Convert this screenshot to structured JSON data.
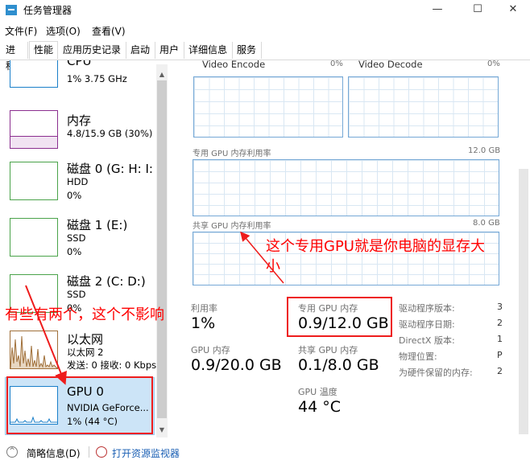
{
  "window": {
    "title": "任务管理器",
    "minimize_glyph": "—",
    "maximize_glyph": "☐",
    "close_glyph": "✕"
  },
  "menu": [
    "文件(F)",
    "选项(O)",
    "查看(V)"
  ],
  "tabs": [
    "进程",
    "性能",
    "应用历史记录",
    "启动",
    "用户",
    "详细信息",
    "服务"
  ],
  "active_tab": "性能",
  "sidebar": {
    "items": [
      {
        "title": "CPU",
        "sub1": "1% 3.75 GHz",
        "sub2": "",
        "sub3": "",
        "color": "#1a7fc9"
      },
      {
        "title": "内存",
        "sub1": "4.8/15.9 GB (30%)",
        "sub2": "",
        "sub3": "",
        "color": "#8b2f8f"
      },
      {
        "title": "磁盘 0 (G: H: I:",
        "sub1": "HDD",
        "sub2": "0%",
        "sub3": "",
        "color": "#4aa34a"
      },
      {
        "title": "磁盘 1 (E:)",
        "sub1": "SSD",
        "sub2": "0%",
        "sub3": "",
        "color": "#4aa34a"
      },
      {
        "title": "磁盘 2 (C: D:)",
        "sub1": "SSD",
        "sub2": "0%",
        "sub3": "",
        "color": "#4aa34a"
      },
      {
        "title": "以太网",
        "sub1": "以太网 2",
        "sub2": "发送: 0 接收: 0 Kbps",
        "sub3": "",
        "color": "#a0703a"
      },
      {
        "title": "GPU 0",
        "sub1": "NVIDIA GeForce...",
        "sub2": "1% (44 °C)",
        "sub3": "",
        "color": "#1a7fc9"
      }
    ],
    "selected": "GPU 0"
  },
  "graphs": {
    "video_encode": {
      "label": "Video Encode",
      "pct": "0%"
    },
    "video_decode": {
      "label": "Video Decode",
      "pct": "0%"
    },
    "dedicated": {
      "label": "专用 GPU 内存利用率",
      "max": "12.0 GB"
    },
    "shared": {
      "label": "共享 GPU 内存利用率",
      "max": "8.0 GB"
    }
  },
  "stats": {
    "utilization": {
      "label": "利用率",
      "value": "1%"
    },
    "dedicated_mem": {
      "label": "专用 GPU 内存",
      "value": "0.9/12.0 GB"
    },
    "gpu_mem": {
      "label": "GPU 内存",
      "value": "0.9/20.0 GB"
    },
    "shared_mem": {
      "label": "共享 GPU 内存",
      "value": "0.1/8.0 GB"
    },
    "gpu_temp": {
      "label": "GPU 温度",
      "value": "44 °C"
    }
  },
  "properties": [
    {
      "label": "驱动程序版本:",
      "value": "3"
    },
    {
      "label": "驱动程序日期:",
      "value": "2"
    },
    {
      "label": "DirectX 版本:",
      "value": "1"
    },
    {
      "label": "物理位置:",
      "value": "P"
    },
    {
      "label": "为硬件保留的内存:",
      "value": "2"
    }
  ],
  "annotations": {
    "right_note_line1": "这个专用GPU就是你电脑的显存大",
    "right_note_line2": "小",
    "left_note": "有些有两个，这个不影响"
  },
  "footer": {
    "summary": "简略信息(D)",
    "resource_monitor": "打开资源监视器"
  }
}
